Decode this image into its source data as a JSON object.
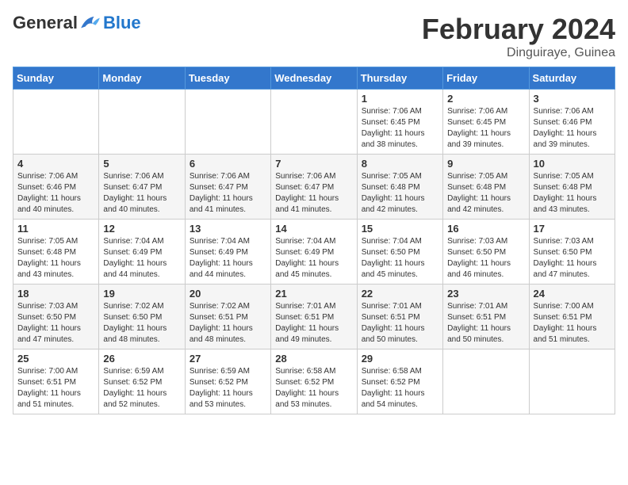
{
  "header": {
    "logo_general": "General",
    "logo_blue": "Blue",
    "month_title": "February 2024",
    "location": "Dinguiraye, Guinea"
  },
  "weekdays": [
    "Sunday",
    "Monday",
    "Tuesday",
    "Wednesday",
    "Thursday",
    "Friday",
    "Saturday"
  ],
  "weeks": [
    [
      {
        "day": "",
        "info": ""
      },
      {
        "day": "",
        "info": ""
      },
      {
        "day": "",
        "info": ""
      },
      {
        "day": "",
        "info": ""
      },
      {
        "day": "1",
        "info": "Sunrise: 7:06 AM\nSunset: 6:45 PM\nDaylight: 11 hours\nand 38 minutes."
      },
      {
        "day": "2",
        "info": "Sunrise: 7:06 AM\nSunset: 6:45 PM\nDaylight: 11 hours\nand 39 minutes."
      },
      {
        "day": "3",
        "info": "Sunrise: 7:06 AM\nSunset: 6:46 PM\nDaylight: 11 hours\nand 39 minutes."
      }
    ],
    [
      {
        "day": "4",
        "info": "Sunrise: 7:06 AM\nSunset: 6:46 PM\nDaylight: 11 hours\nand 40 minutes."
      },
      {
        "day": "5",
        "info": "Sunrise: 7:06 AM\nSunset: 6:47 PM\nDaylight: 11 hours\nand 40 minutes."
      },
      {
        "day": "6",
        "info": "Sunrise: 7:06 AM\nSunset: 6:47 PM\nDaylight: 11 hours\nand 41 minutes."
      },
      {
        "day": "7",
        "info": "Sunrise: 7:06 AM\nSunset: 6:47 PM\nDaylight: 11 hours\nand 41 minutes."
      },
      {
        "day": "8",
        "info": "Sunrise: 7:05 AM\nSunset: 6:48 PM\nDaylight: 11 hours\nand 42 minutes."
      },
      {
        "day": "9",
        "info": "Sunrise: 7:05 AM\nSunset: 6:48 PM\nDaylight: 11 hours\nand 42 minutes."
      },
      {
        "day": "10",
        "info": "Sunrise: 7:05 AM\nSunset: 6:48 PM\nDaylight: 11 hours\nand 43 minutes."
      }
    ],
    [
      {
        "day": "11",
        "info": "Sunrise: 7:05 AM\nSunset: 6:48 PM\nDaylight: 11 hours\nand 43 minutes."
      },
      {
        "day": "12",
        "info": "Sunrise: 7:04 AM\nSunset: 6:49 PM\nDaylight: 11 hours\nand 44 minutes."
      },
      {
        "day": "13",
        "info": "Sunrise: 7:04 AM\nSunset: 6:49 PM\nDaylight: 11 hours\nand 44 minutes."
      },
      {
        "day": "14",
        "info": "Sunrise: 7:04 AM\nSunset: 6:49 PM\nDaylight: 11 hours\nand 45 minutes."
      },
      {
        "day": "15",
        "info": "Sunrise: 7:04 AM\nSunset: 6:50 PM\nDaylight: 11 hours\nand 45 minutes."
      },
      {
        "day": "16",
        "info": "Sunrise: 7:03 AM\nSunset: 6:50 PM\nDaylight: 11 hours\nand 46 minutes."
      },
      {
        "day": "17",
        "info": "Sunrise: 7:03 AM\nSunset: 6:50 PM\nDaylight: 11 hours\nand 47 minutes."
      }
    ],
    [
      {
        "day": "18",
        "info": "Sunrise: 7:03 AM\nSunset: 6:50 PM\nDaylight: 11 hours\nand 47 minutes."
      },
      {
        "day": "19",
        "info": "Sunrise: 7:02 AM\nSunset: 6:50 PM\nDaylight: 11 hours\nand 48 minutes."
      },
      {
        "day": "20",
        "info": "Sunrise: 7:02 AM\nSunset: 6:51 PM\nDaylight: 11 hours\nand 48 minutes."
      },
      {
        "day": "21",
        "info": "Sunrise: 7:01 AM\nSunset: 6:51 PM\nDaylight: 11 hours\nand 49 minutes."
      },
      {
        "day": "22",
        "info": "Sunrise: 7:01 AM\nSunset: 6:51 PM\nDaylight: 11 hours\nand 50 minutes."
      },
      {
        "day": "23",
        "info": "Sunrise: 7:01 AM\nSunset: 6:51 PM\nDaylight: 11 hours\nand 50 minutes."
      },
      {
        "day": "24",
        "info": "Sunrise: 7:00 AM\nSunset: 6:51 PM\nDaylight: 11 hours\nand 51 minutes."
      }
    ],
    [
      {
        "day": "25",
        "info": "Sunrise: 7:00 AM\nSunset: 6:51 PM\nDaylight: 11 hours\nand 51 minutes."
      },
      {
        "day": "26",
        "info": "Sunrise: 6:59 AM\nSunset: 6:52 PM\nDaylight: 11 hours\nand 52 minutes."
      },
      {
        "day": "27",
        "info": "Sunrise: 6:59 AM\nSunset: 6:52 PM\nDaylight: 11 hours\nand 53 minutes."
      },
      {
        "day": "28",
        "info": "Sunrise: 6:58 AM\nSunset: 6:52 PM\nDaylight: 11 hours\nand 53 minutes."
      },
      {
        "day": "29",
        "info": "Sunrise: 6:58 AM\nSunset: 6:52 PM\nDaylight: 11 hours\nand 54 minutes."
      },
      {
        "day": "",
        "info": ""
      },
      {
        "day": "",
        "info": ""
      }
    ]
  ]
}
